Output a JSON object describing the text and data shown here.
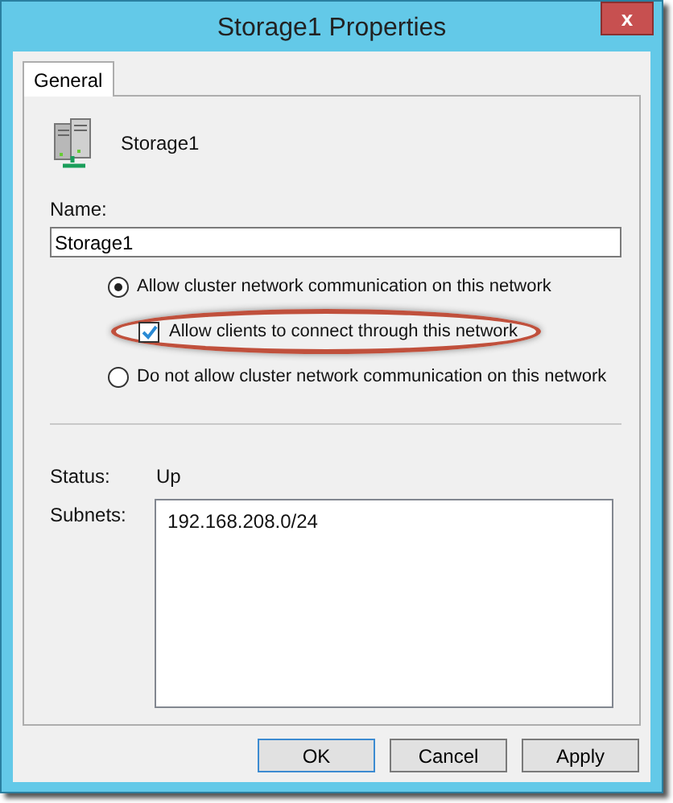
{
  "window": {
    "title": "Storage1 Properties",
    "close_glyph": "x"
  },
  "tabs": [
    {
      "label": "General",
      "selected": true
    }
  ],
  "network": {
    "name": "Storage1"
  },
  "name_field": {
    "label": "Name:",
    "value": "Storage1"
  },
  "options": [
    {
      "kind": "radio",
      "label": "Allow cluster network communication on this network",
      "selected": true
    },
    {
      "kind": "checkbox",
      "label": "Allow clients to connect through this network",
      "checked": true,
      "highlighted": true
    },
    {
      "kind": "radio",
      "label": "Do not allow cluster network communication on this network",
      "selected": false
    }
  ],
  "status": {
    "label": "Status:",
    "value": "Up"
  },
  "subnets": {
    "label": "Subnets:",
    "items": [
      "192.168.208.0/24"
    ]
  },
  "buttons": [
    {
      "label": "OK",
      "default": true
    },
    {
      "label": "Cancel",
      "default": false
    },
    {
      "label": "Apply",
      "default": false
    }
  ]
}
